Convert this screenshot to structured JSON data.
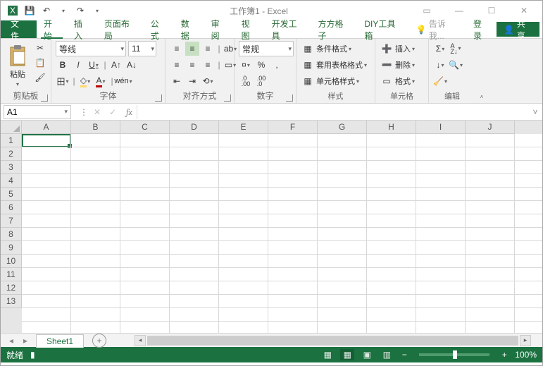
{
  "title": "工作簿1 - Excel",
  "qat": {
    "save": "💾",
    "undo": "↶",
    "redo": "↷",
    "more": "▾"
  },
  "win": {
    "ribbon_opts": "▭",
    "min": "—",
    "max": "☐",
    "close": "✕"
  },
  "tabs": {
    "file": "文件",
    "home": "开始",
    "insert": "插入",
    "layout": "页面布局",
    "formulas": "公式",
    "data": "数据",
    "review": "审阅",
    "view": "视图",
    "developer": "开发工具",
    "fangfang": "方方格子",
    "diy": "DIY工具箱",
    "tell": "告诉我...",
    "login": "登录",
    "share": "共享"
  },
  "groups": {
    "clipboard": {
      "label": "剪贴板",
      "paste": "粘贴"
    },
    "font": {
      "label": "字体",
      "name": "等线",
      "size": "11",
      "bold": "B",
      "italic": "I",
      "underline": "U",
      "border": "田",
      "fill": "◇",
      "color": "A",
      "phonetic": "wén"
    },
    "align": {
      "label": "对齐方式",
      "wrap": "┇",
      "merge": "合"
    },
    "number": {
      "label": "数字",
      "format": "常规",
      "currency": "¤",
      "percent": "%",
      "comma": ",",
      "inc": ".0\n.00",
      "dec": ".00\n.0"
    },
    "styles": {
      "label": "样式",
      "cond": "条件格式",
      "table": "套用表格格式",
      "cell": "单元格样式"
    },
    "cells": {
      "label": "单元格",
      "insert": "插入",
      "delete": "删除",
      "format": "格式"
    },
    "editing": {
      "label": "编辑",
      "sum": "Σ",
      "fill": "↓",
      "clear": "◇",
      "sort": "A\nZ",
      "find": "🔍"
    }
  },
  "namebox": {
    "value": "A1"
  },
  "fx": {
    "cancel": "✕",
    "enter": "✓",
    "fx": "fx"
  },
  "columns": [
    "A",
    "B",
    "C",
    "D",
    "E",
    "F",
    "G",
    "H",
    "I",
    "J"
  ],
  "rows": [
    "1",
    "2",
    "3",
    "4",
    "5",
    "6",
    "7",
    "8",
    "9",
    "10",
    "11",
    "12",
    "13"
  ],
  "sheet": {
    "name": "Sheet1",
    "new": "+"
  },
  "status": {
    "ready": "就绪",
    "zoom": "100%",
    "minus": "−",
    "plus": "+"
  }
}
